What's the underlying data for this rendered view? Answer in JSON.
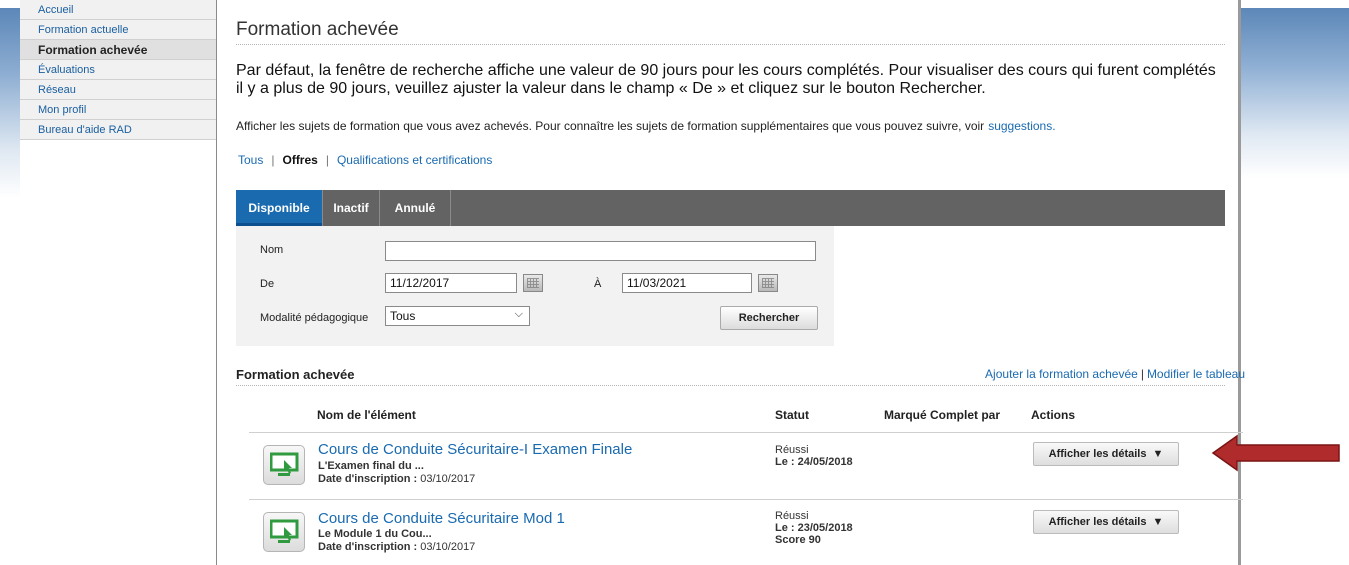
{
  "colors": {
    "link": "#1a6ab0",
    "tab_bar": "#636363",
    "tab_active": "#1a6ab0",
    "callout_arrow": "#b02b2b",
    "form_bg": "#f2f2f2"
  },
  "sidebar": {
    "items": [
      {
        "label": "Accueil"
      },
      {
        "label": "Formation actuelle"
      },
      {
        "label": "Formation achevée"
      },
      {
        "label": "Évaluations"
      },
      {
        "label": "Réseau"
      },
      {
        "label": "Mon profil"
      },
      {
        "label": "Bureau d'aide RAD"
      }
    ]
  },
  "main": {
    "title": "Formation achevée",
    "intro": "Par défaut, la fenêtre de recherche affiche une valeur de 90 jours pour les cours complétés. Pour visualiser des cours qui furent complétés il y a plus de 90 jours, veuillez ajuster la valeur dans le champ « De » et cliquez sur le bouton Rechercher.",
    "note": "Afficher les sujets de formation que vous avez achevés. Pour connaître les sujets de formation supplémentaires que vous pouvez suivre, voir",
    "note_link": "suggestions.",
    "filters": {
      "all": "Tous",
      "offers": "Offres",
      "qualifications": "Qualifications et certifications",
      "separator": "|"
    },
    "tabs": [
      {
        "label": "Disponible"
      },
      {
        "label": "Inactif"
      },
      {
        "label": "Annulé"
      }
    ],
    "form": {
      "name_label": "Nom",
      "name_value": "",
      "from_label": "De",
      "from_value": "11/12/2017",
      "to_label": "À",
      "to_value": "11/03/2021",
      "modality_label": "Modalité pédagogique",
      "modality_value": "Tous",
      "search_button": "Rechercher"
    },
    "completed": {
      "title": "Formation achevée",
      "add_link": "Ajouter la formation achevée",
      "links_separator": "|",
      "edit_link": "Modifier le tableau",
      "columns": [
        "Nom de l'élément",
        "Statut",
        "Marqué Complet par",
        "Actions"
      ],
      "rows": [
        {
          "name": "Cours de Conduite Sécuritaire-I Examen Finale",
          "description": "L'Examen final du ...",
          "enroll_label": "Date d'inscription :",
          "enroll_date": "03/10/2017",
          "status": "Réussi",
          "date_label": "Le :",
          "date": "24/05/2018",
          "score": "",
          "action": "Afficher les détails",
          "action_icon": "▼"
        },
        {
          "name": "Cours de Conduite Sécuritaire Mod 1",
          "description": "Le Module 1 du Cou...",
          "enroll_label": "Date d'inscription :",
          "enroll_date": "03/10/2017",
          "status": "Réussi",
          "date_label": "Le :",
          "date": "23/05/2018",
          "score": "Score 90",
          "action": "Afficher les détails",
          "action_icon": "▼"
        }
      ]
    }
  }
}
